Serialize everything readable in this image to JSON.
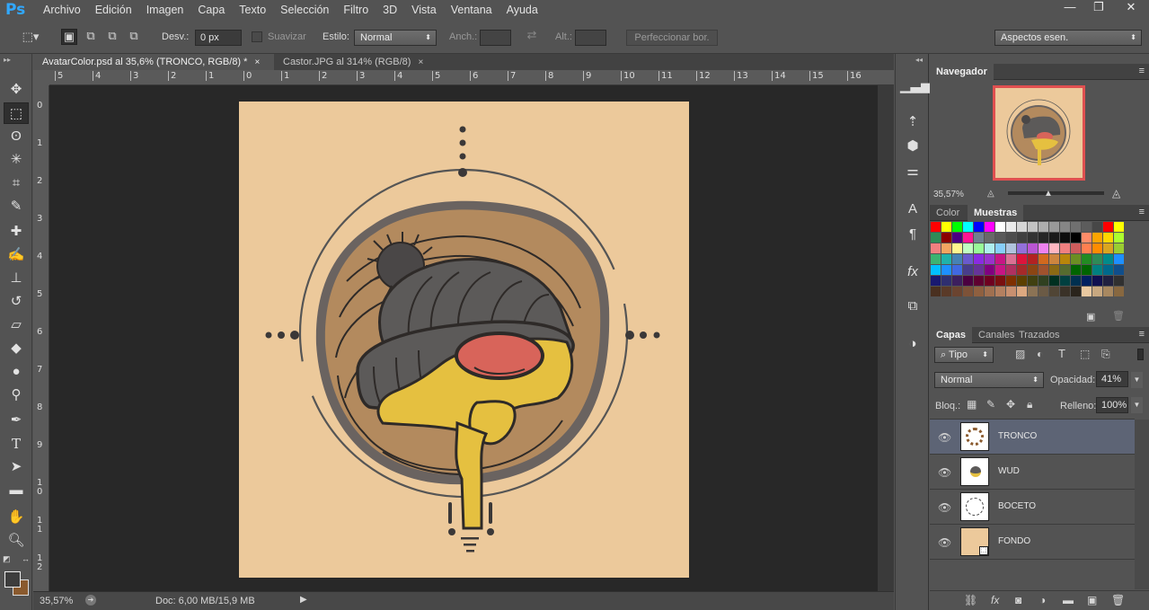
{
  "app": {
    "logo": "Ps"
  },
  "menu": [
    "Archivo",
    "Edición",
    "Imagen",
    "Capa",
    "Texto",
    "Selección",
    "Filtro",
    "3D",
    "Vista",
    "Ventana",
    "Ayuda"
  ],
  "window_controls": {
    "minimize": "—",
    "restore": "❐",
    "close": "✕"
  },
  "options": {
    "feather_label": "Desv.:",
    "feather_value": "0 px",
    "antialias_label": "Suavizar",
    "style_label": "Estilo:",
    "style_value": "Normal",
    "width_label": "Anch.:",
    "height_label": "Alt.:",
    "refine_edge": "Perfeccionar bor.",
    "workspace": "Aspectos esen."
  },
  "tabs": [
    {
      "label": "AvatarColor.psd al 35,6% (TRONCO, RGB/8) *",
      "close": "×"
    },
    {
      "label": "Castor.JPG al 314% (RGB/8)",
      "close": "×"
    }
  ],
  "ruler_h": [
    "5",
    "4",
    "3",
    "2",
    "1",
    "0",
    "1",
    "2",
    "3",
    "4",
    "5",
    "6",
    "7",
    "8",
    "9",
    "10",
    "11",
    "12",
    "13",
    "14",
    "15",
    "16"
  ],
  "ruler_v": [
    "0",
    "1",
    "2",
    "3",
    "4",
    "5",
    "6",
    "7",
    "8",
    "9",
    "1 0",
    "1 1",
    "1 2"
  ],
  "status": {
    "zoom": "35,57%",
    "doc": "Doc: 6,00 MB/15,9 MB"
  },
  "colors": {
    "artboard": "#ecc99b",
    "accent_selected_layer": "#5d6475",
    "navigator_box": "#e05050"
  },
  "navigator": {
    "title": "Navegador",
    "zoom": "35,57%"
  },
  "color_panel": {
    "tab_color": "Color",
    "tab_swatches": "Muestras"
  },
  "swatches": [
    [
      "#ff0000",
      "#ffff00",
      "#00ff00",
      "#00ffff",
      "#0000ff",
      "#ff00ff",
      "#ffffff",
      "#ebebeb",
      "#d6d6d6",
      "#c2c2c2",
      "#adadad",
      "#999999",
      "#858585",
      "#707070",
      "#5c5c5c",
      "#474747",
      "#ff0000",
      "#ffff00"
    ],
    [
      "#2e8b57",
      "#8b0000",
      "#4b0082",
      "#ff1493",
      "#708090",
      "#696969",
      "#595959",
      "#4d4d4d",
      "#404040",
      "#333333",
      "#262626",
      "#1a1a1a",
      "#0d0d0d",
      "#000000",
      "#ff8c69",
      "#ffa500",
      "#ffd700",
      "#adff2f"
    ],
    [
      "#f08080",
      "#f4a460",
      "#fff68f",
      "#c1ffc1",
      "#98fb98",
      "#aeeeee",
      "#87cefa",
      "#b0c4de",
      "#9370db",
      "#ba55d3",
      "#ee82ee",
      "#ffb6c1",
      "#f08080",
      "#cd5c5c",
      "#ff7f50",
      "#ff8c00",
      "#daa520",
      "#9acd32"
    ],
    [
      "#3cb371",
      "#20b2aa",
      "#4682b4",
      "#6a5acd",
      "#8a2be2",
      "#9932cc",
      "#c71585",
      "#db7093",
      "#dc143c",
      "#b22222",
      "#d2691e",
      "#cd853f",
      "#b8860b",
      "#6b8e23",
      "#228b22",
      "#2e8b57",
      "#008b8b",
      "#1e90ff"
    ],
    [
      "#00bfff",
      "#1e90ff",
      "#4169e1",
      "#483d8b",
      "#663399",
      "#800080",
      "#c71585",
      "#b03060",
      "#a52a2a",
      "#8b4513",
      "#a0522d",
      "#8b6914",
      "#556b2f",
      "#006400",
      "#006400",
      "#008080",
      "#00688b",
      "#104e8b"
    ],
    [
      "#191970",
      "#2f2f6f",
      "#3c1f5e",
      "#4b0040",
      "#5e0030",
      "#6e0020",
      "#7a1010",
      "#7f3000",
      "#5c4000",
      "#404010",
      "#304020",
      "#003020",
      "#004040",
      "#003050",
      "#002060",
      "#101050",
      "#202040",
      "#303030"
    ],
    [
      "#4a3020",
      "#5a3a28",
      "#6b4430",
      "#7d5238",
      "#8f6040",
      "#a07050",
      "#b48060",
      "#c89070",
      "#dca880",
      "#8b7355",
      "#6b5a45",
      "#504535",
      "#3a3228",
      "#2a241c",
      "#e8c8a0",
      "#c8a880",
      "#a88860",
      "#886840"
    ]
  ],
  "layers_panel": {
    "tab_layers": "Capas",
    "tab_channels": "Canales",
    "tab_paths": "Trazados",
    "kind": "Tipo",
    "blend": "Normal",
    "opacity_label": "Opacidad:",
    "opacity": "41%",
    "lock_label": "Bloq.:",
    "fill_label": "Relleno:",
    "fill": "100%"
  },
  "layers": [
    {
      "name": "TRONCO",
      "selected": true
    },
    {
      "name": "WUD",
      "selected": false
    },
    {
      "name": "BOCETO",
      "selected": false
    },
    {
      "name": "FONDO",
      "selected": false
    }
  ]
}
